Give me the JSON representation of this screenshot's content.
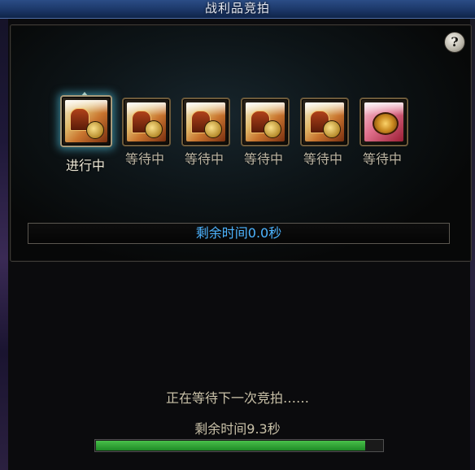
{
  "window": {
    "title": "战利品竞拍"
  },
  "help": {
    "glyph": "?"
  },
  "auction_items": [
    {
      "status": "进行中",
      "icon": "treasure-chest-coin-icon",
      "active": true
    },
    {
      "status": "等待中",
      "icon": "treasure-chest-coin-icon",
      "active": false
    },
    {
      "status": "等待中",
      "icon": "treasure-chest-coin-icon",
      "active": false
    },
    {
      "status": "等待中",
      "icon": "treasure-chest-coin-icon",
      "active": false
    },
    {
      "status": "等待中",
      "icon": "treasure-chest-coin-icon",
      "active": false
    },
    {
      "status": "等待中",
      "icon": "gold-ring-icon",
      "active": false
    }
  ],
  "current_auction": {
    "remaining_time": "剩余时间0.0秒"
  },
  "next_auction": {
    "waiting_message": "正在等待下一次竞拍……",
    "remaining_time": "剩余时间9.3秒",
    "progress_fraction": 0.94
  },
  "colors": {
    "accent_blue": "#4db4ff",
    "progress_green": "#1e8a25",
    "active_glow": "#50c8e6"
  }
}
